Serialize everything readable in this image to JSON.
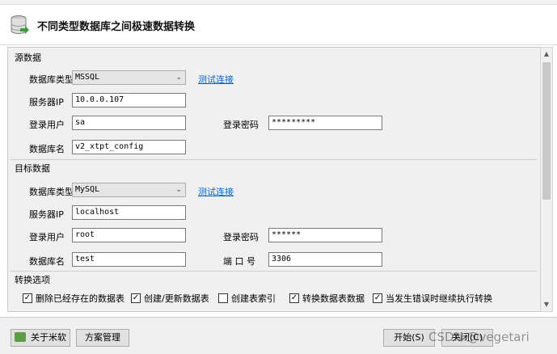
{
  "window": {
    "title": "不同类型数据库之间极速数据转换"
  },
  "source": {
    "section_title": "源数据",
    "db_type_label": "数据库类型",
    "db_type_value": "MSSQL",
    "test_link": "测试连接",
    "server_label": "服务器IP",
    "server_value": "10.0.0.107",
    "user_label": "登录用户",
    "user_value": "sa",
    "password_label": "登录密码",
    "password_value": "*********",
    "dbname_label": "数据库名",
    "dbname_value": "v2_xtpt_config"
  },
  "target": {
    "section_title": "目标数据",
    "db_type_label": "数据库类型",
    "db_type_value": "MySQL",
    "test_link": "测试连接",
    "server_label": "服务器IP",
    "server_value": "localhost",
    "user_label": "登录用户",
    "user_value": "root",
    "password_label": "登录密码",
    "password_value": "******",
    "dbname_label": "数据库名",
    "dbname_value": "test",
    "port_label": "端 口 号",
    "port_value": "3306"
  },
  "options": {
    "section_title": "转换选项",
    "items": [
      {
        "label": "删除已经存在的数据表",
        "checked": true
      },
      {
        "label": "创建/更新数据表",
        "checked": true
      },
      {
        "label": "创建表索引",
        "checked": false
      },
      {
        "label": "转换数据表数据",
        "checked": true
      },
      {
        "label": "当发生错误时继续执行转换",
        "checked": true
      }
    ]
  },
  "buttons": {
    "about": "关于米软",
    "manage": "方案管理",
    "start": "开始(S)",
    "close": "关闭(C)"
  },
  "watermark": "CSDN @vegetari",
  "colors": {
    "link": "#0066cc",
    "panel": "#f0f0f0",
    "icon_green": "#5a9e46"
  }
}
